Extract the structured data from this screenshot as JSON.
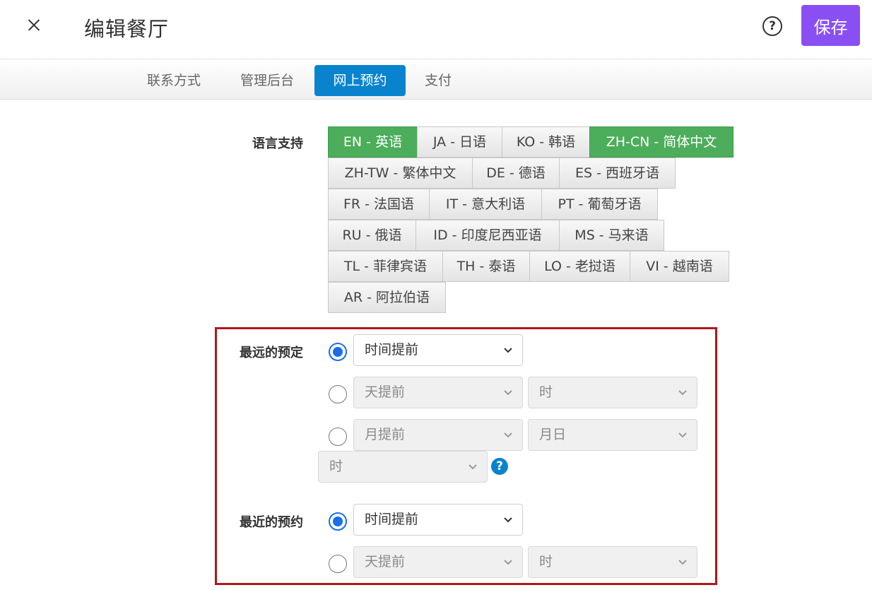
{
  "header": {
    "title": "编辑餐厅",
    "help_icon_glyph": "?",
    "save_label": "保存"
  },
  "tabs": [
    {
      "label": "联系方式",
      "active": false
    },
    {
      "label": "管理后台",
      "active": false
    },
    {
      "label": "网上预约",
      "active": true
    },
    {
      "label": "支付",
      "active": false
    }
  ],
  "languages": {
    "label": "语言支持",
    "items": [
      {
        "label": "EN - 英语",
        "selected": true
      },
      {
        "label": "JA - 日语",
        "selected": false
      },
      {
        "label": "KO - 韩语",
        "selected": false
      },
      {
        "label": "ZH-CN - 简体中文",
        "selected": true
      },
      {
        "label": "ZH-TW - 繁体中文",
        "selected": false
      },
      {
        "label": "DE - 德语",
        "selected": false
      },
      {
        "label": "ES - 西班牙语",
        "selected": false
      },
      {
        "label": "FR - 法国语",
        "selected": false
      },
      {
        "label": "IT - 意大利语",
        "selected": false
      },
      {
        "label": "PT - 葡萄牙语",
        "selected": false
      },
      {
        "label": "RU - 俄语",
        "selected": false
      },
      {
        "label": "ID - 印度尼西亚语",
        "selected": false
      },
      {
        "label": "MS - 马来语",
        "selected": false
      },
      {
        "label": "TL - 菲律宾语",
        "selected": false
      },
      {
        "label": "TH - 泰语",
        "selected": false
      },
      {
        "label": "LO - 老挝语",
        "selected": false
      },
      {
        "label": "VI - 越南语",
        "selected": false
      },
      {
        "label": "AR - 阿拉伯语",
        "selected": false
      }
    ]
  },
  "furthest_booking": {
    "label": "最远的预定",
    "option1_select": "时间提前",
    "option2_select_a": "天提前",
    "option2_select_b": "时",
    "option3_select_a": "月提前",
    "option3_select_b": "月日",
    "option3_select_c": "时",
    "help_glyph": "?"
  },
  "nearest_booking": {
    "label": "最近的预约",
    "option1_select": "时间提前",
    "option2_select_a": "天提前",
    "option2_select_b": "时"
  },
  "colors": {
    "save_button": "#8a4ff2",
    "active_tab": "#0a83cf",
    "selected_language": "#4cad5a",
    "highlight_border": "#b2161b",
    "radio_checked": "#1a6fe8"
  }
}
